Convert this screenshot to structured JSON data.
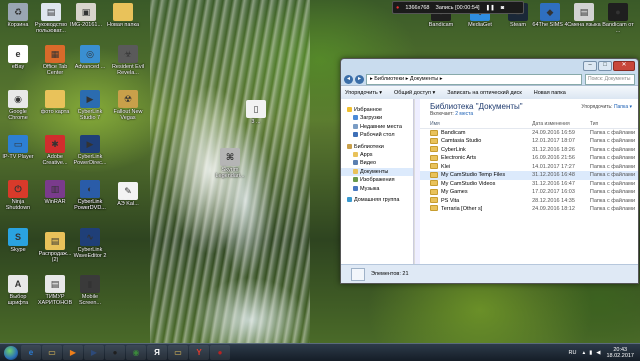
{
  "recording_bar": {
    "resolution": "1366x768",
    "status": "Запись [00:00:54]"
  },
  "desktop_icons": [
    {
      "label": "Корзина",
      "icon": "recycle-bin-icon",
      "color": "#9aa6b3",
      "glyph": "♻"
    },
    {
      "label": "Руководство пользоват...",
      "icon": "document-icon",
      "color": "#dfe6ee",
      "glyph": "▤"
    },
    {
      "label": "IMG-20161...",
      "icon": "image-icon",
      "color": "#d8d4cc",
      "glyph": "▣"
    },
    {
      "label": "Новая папка",
      "icon": "folder-icon",
      "color": "#e9c25a",
      "glyph": ""
    },
    {
      "label": "eBay",
      "icon": "ebay-icon",
      "color": "#ffffff",
      "glyph": "e"
    },
    {
      "label": "Office Tab Center",
      "icon": "office-tab-icon",
      "color": "#d96a2a",
      "glyph": "▦"
    },
    {
      "label": "Advanced ...",
      "icon": "advanced-icon",
      "color": "#3a8fd1",
      "glyph": "◎"
    },
    {
      "label": "Resident Evil Revela...",
      "icon": "game-icon",
      "color": "#5a5a5a",
      "glyph": "☣"
    },
    {
      "label": "Google Chrome",
      "icon": "chrome-icon",
      "color": "#e8e8e8",
      "glyph": "◉"
    },
    {
      "label": "фото карта",
      "icon": "folder-icon",
      "color": "#e9c25a",
      "glyph": ""
    },
    {
      "label": "CyberLink Studio 7",
      "icon": "cyberlink-icon",
      "color": "#2b6cb0",
      "glyph": "▶"
    },
    {
      "label": "Fallout New Vegas",
      "icon": "fallout-icon",
      "color": "#c9a04a",
      "glyph": "☢"
    },
    {
      "label": "IP-TV Player",
      "icon": "tv-icon",
      "color": "#2d7fd3",
      "glyph": "▭"
    },
    {
      "label": "Adobe Creative...",
      "icon": "adobe-icon",
      "color": "#d12d2d",
      "glyph": "✱"
    },
    {
      "label": "CyberLink PowerDirec...",
      "icon": "powerdirector-icon",
      "color": "#1f3f78",
      "glyph": "▶"
    },
    {
      "label": "3 ...",
      "icon": "file-icon",
      "color": "#f2f2f2",
      "glyph": "▯"
    },
    {
      "label": "Skyrim Legendari...",
      "icon": "skyrim-icon",
      "color": "#b5b5b5",
      "glyph": "⌘"
    },
    {
      "label": "Ninja Shutdown",
      "icon": "power-icon",
      "color": "#d83a2a",
      "glyph": "⏻"
    },
    {
      "label": "WinRAR",
      "icon": "winrar-icon",
      "color": "#7a3b8c",
      "glyph": "▥"
    },
    {
      "label": "CyberLink PowerDVD...",
      "icon": "powerdvd-icon",
      "color": "#2a5ca8",
      "glyph": "◐"
    },
    {
      "label": "CyberLink PowerDVD...",
      "icon": "powerdvd-icon",
      "color": "#2a5ca8",
      "glyph": "◐"
    },
    {
      "label": "АЭ Kal...",
      "icon": "pdf-icon",
      "color": "#f3f3f3",
      "glyph": "✎"
    },
    {
      "label": "Skype",
      "icon": "skype-icon",
      "color": "#2aa3e0",
      "glyph": "S"
    },
    {
      "label": "Распродаж... (2)",
      "icon": "document-icon",
      "color": "#e9c25a",
      "glyph": "▤"
    },
    {
      "label": "CyberLink WaveEditor 2",
      "icon": "waveeditor-icon",
      "color": "#1f3f78",
      "glyph": "∿"
    },
    {
      "label": "Выбор шрифта",
      "icon": "document-icon",
      "color": "#e8e8e8",
      "glyph": "A"
    },
    {
      "label": "ТИМУР ХАРИТОНОВ",
      "icon": "document-icon",
      "color": "#e8e8e8",
      "glyph": "▤"
    },
    {
      "label": "Mobile Screen...",
      "icon": "mobile-icon",
      "color": "#3a3a3a",
      "glyph": "▮"
    },
    {
      "label": "Bandicam",
      "icon": "bandicam-icon",
      "color": "#1f1f1f",
      "glyph": "●"
    },
    {
      "label": "MediaGet",
      "icon": "mediaget-icon",
      "color": "#2f8de0",
      "glyph": "⬇"
    },
    {
      "label": "Steam",
      "icon": "steam-icon",
      "color": "#1b2838",
      "glyph": "⚙"
    },
    {
      "label": "64The SIMS 4",
      "icon": "sims-icon",
      "color": "#2f6fbf",
      "glyph": "◆"
    },
    {
      "label": "Смена языка",
      "icon": "language-icon",
      "color": "#d2d2d2",
      "glyph": "▤"
    },
    {
      "label": "Bandicam от ...",
      "icon": "bandicam-icon",
      "color": "#1f1f1f",
      "glyph": "●"
    }
  ],
  "explorer": {
    "window_buttons": {
      "minimize": "–",
      "maximize": "□",
      "close": "✕"
    },
    "address": "▸ Библиотеки ▸ Документы ▸",
    "search_placeholder": "Поиск: Документы",
    "toolbar": [
      "Упорядочить ▾",
      "Общий доступ ▾",
      "Записать на оптический диск",
      "Новая папка"
    ],
    "nav": {
      "favorites": "Избранное",
      "fav_items": [
        "Загрузки",
        "Недавние места",
        "Рабочий стол"
      ],
      "libraries": "Библиотеки",
      "lib_items": [
        "Apps",
        "Видео",
        "Документы",
        "Изображения",
        "Музыка"
      ],
      "homegroup": "Домашняя группа"
    },
    "library_title": "Библиотека \"Документы\"",
    "includes_prefix": "Включает:",
    "includes_value": "2 места",
    "arrange_prefix": "Упорядочить:",
    "arrange_value": "Папка ▾",
    "columns": {
      "name": "Имя",
      "date": "Дата изменения",
      "type": "Тип"
    },
    "files": [
      {
        "name": "Bandicam",
        "date": "24.09.2016 16:59",
        "type": "Папка с файлами"
      },
      {
        "name": "Camtasia Studio",
        "date": "12.01.2017 18:07",
        "type": "Папка с файлами"
      },
      {
        "name": "CyberLink",
        "date": "31.12.2016 18:26",
        "type": "Папка с файлами"
      },
      {
        "name": "Electronic Arts",
        "date": "16.09.2016 21:56",
        "type": "Папка с файлами"
      },
      {
        "name": "Klei",
        "date": "14.01.2017 17:27",
        "type": "Папка с файлами"
      },
      {
        "name": "My CamStudio Temp Files",
        "date": "31.12.2016 16:48",
        "type": "Папка с файлами"
      },
      {
        "name": "My CamStudio Videos",
        "date": "31.12.2016 16:47",
        "type": "Папка с файлами"
      },
      {
        "name": "My Games",
        "date": "17.02.2017 16:03",
        "type": "Папка с файлами"
      },
      {
        "name": "PS Vita",
        "date": "28.12.2016 14:35",
        "type": "Папка с файлами"
      },
      {
        "name": "Terraria [Other s]",
        "date": "24.09.2016 18:12",
        "type": "Папка с файлами"
      }
    ],
    "status": "Элементов: 21"
  },
  "taskbar": {
    "apps": [
      {
        "name": "ie-icon",
        "glyph": "e",
        "color": "#2a7bd3"
      },
      {
        "name": "explorer-icon",
        "glyph": "▭",
        "color": "#e9c25a"
      },
      {
        "name": "media-player-icon",
        "glyph": "▶",
        "color": "#ef7f1a"
      },
      {
        "name": "video-icon",
        "glyph": "▶",
        "color": "#2d4a7a"
      },
      {
        "name": "bandicam-icon",
        "glyph": "●",
        "color": "#1f1f1f"
      },
      {
        "name": "chrome-icon",
        "glyph": "◉",
        "color": "#3b8a3b"
      },
      {
        "name": "yandex-icon",
        "glyph": "Я",
        "color": "#ffffff"
      },
      {
        "name": "explorer-icon",
        "glyph": "▭",
        "color": "#e9c25a"
      },
      {
        "name": "yandex-browser-icon",
        "glyph": "Y",
        "color": "#e63b2e"
      },
      {
        "name": "bandicam-icon",
        "glyph": "●",
        "color": "#b22"
      }
    ],
    "language": "RU",
    "time": "20:43",
    "date": "18.02.2017"
  }
}
